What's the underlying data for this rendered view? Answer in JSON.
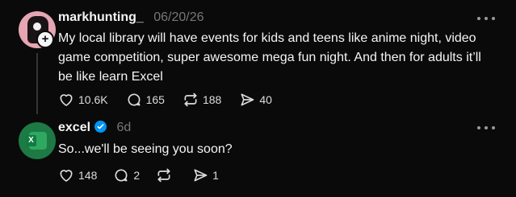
{
  "post1": {
    "username": "markhunting_",
    "timestamp": "06/20/26",
    "text": "My local library will have events for kids and teens like anime night, video game competition, super awesome mega fun night. And then for adults it’ll be like learn Excel",
    "likes": "10.6K",
    "replies": "165",
    "reposts": "188",
    "shares": "40"
  },
  "post2": {
    "username": "excel",
    "timestamp": "6d",
    "avatar_letter": "X",
    "text": "So...we'll be seeing you soon?",
    "likes": "148",
    "replies": "2",
    "reposts": "",
    "shares": "1"
  },
  "icons": {
    "like": "heart-icon",
    "reply": "comment-icon",
    "repost": "repost-icon",
    "share": "send-icon",
    "more": "more-icon",
    "verified": "verified-badge-icon",
    "follow": "plus-icon"
  },
  "colors": {
    "background": "#0a0a0a",
    "text": "#f3f5f7",
    "muted": "#777777",
    "verified": "#0095f6",
    "excel_green": "#107c41"
  }
}
